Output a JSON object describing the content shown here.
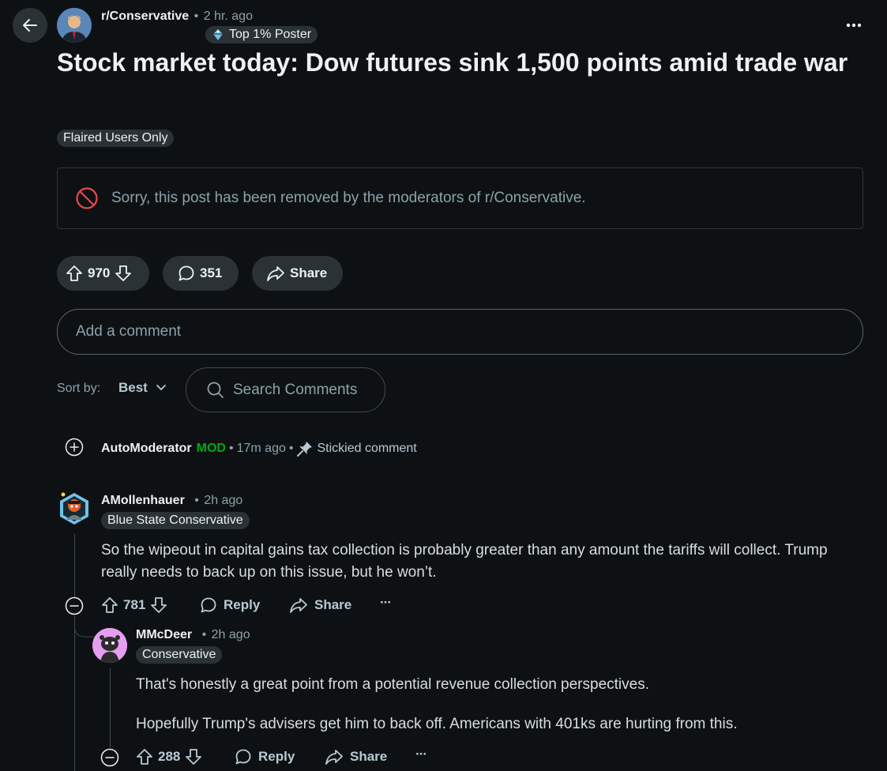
{
  "post": {
    "subreddit": "r/Conservative",
    "separator": "•",
    "time": "2 hr. ago",
    "badge": "Top 1% Poster",
    "title": "Stock market today: Dow futures sink 1,500 points amid trade war",
    "flair": "Flaired Users Only",
    "removed_notice": "Sorry, this post has been removed by the moderators of r/Conservative.",
    "votes": "970",
    "comments": "351",
    "share_label": "Share"
  },
  "comment_box": {
    "placeholder": "Add a comment"
  },
  "sort": {
    "label": "Sort by:",
    "value": "Best"
  },
  "search": {
    "placeholder": "Search Comments"
  },
  "stickied": {
    "author": "AutoModerator",
    "mod_tag": "MOD",
    "time": "17m ago",
    "note": "Stickied comment"
  },
  "comments": [
    {
      "author": "AMollenhauer",
      "time": "2h ago",
      "flair": "Blue State Conservative",
      "body": "So the wipeout in capital gains tax collection is probably greater than any amount the tariffs will collect. Trump really needs to back up on this issue, but he won’t.",
      "votes": "781",
      "reply_label": "Reply",
      "share_label": "Share",
      "more": "···"
    },
    {
      "author": "MMcDeer",
      "time": "2h ago",
      "flair": "Conservative",
      "body_1": "That's honestly a great point from a potential revenue collection perspectives.",
      "body_2": "Hopefully Trump's advisers get him to back off. Americans with 401ks are hurting from this.",
      "votes": "288",
      "reply_label": "Reply",
      "share_label": "Share",
      "more": "···"
    }
  ],
  "colors": {
    "background": "#0e1113",
    "button": "#2a3236",
    "mod_green": "#01a816",
    "removed_red": "#e5484d",
    "muted": "#8ba2ad"
  }
}
